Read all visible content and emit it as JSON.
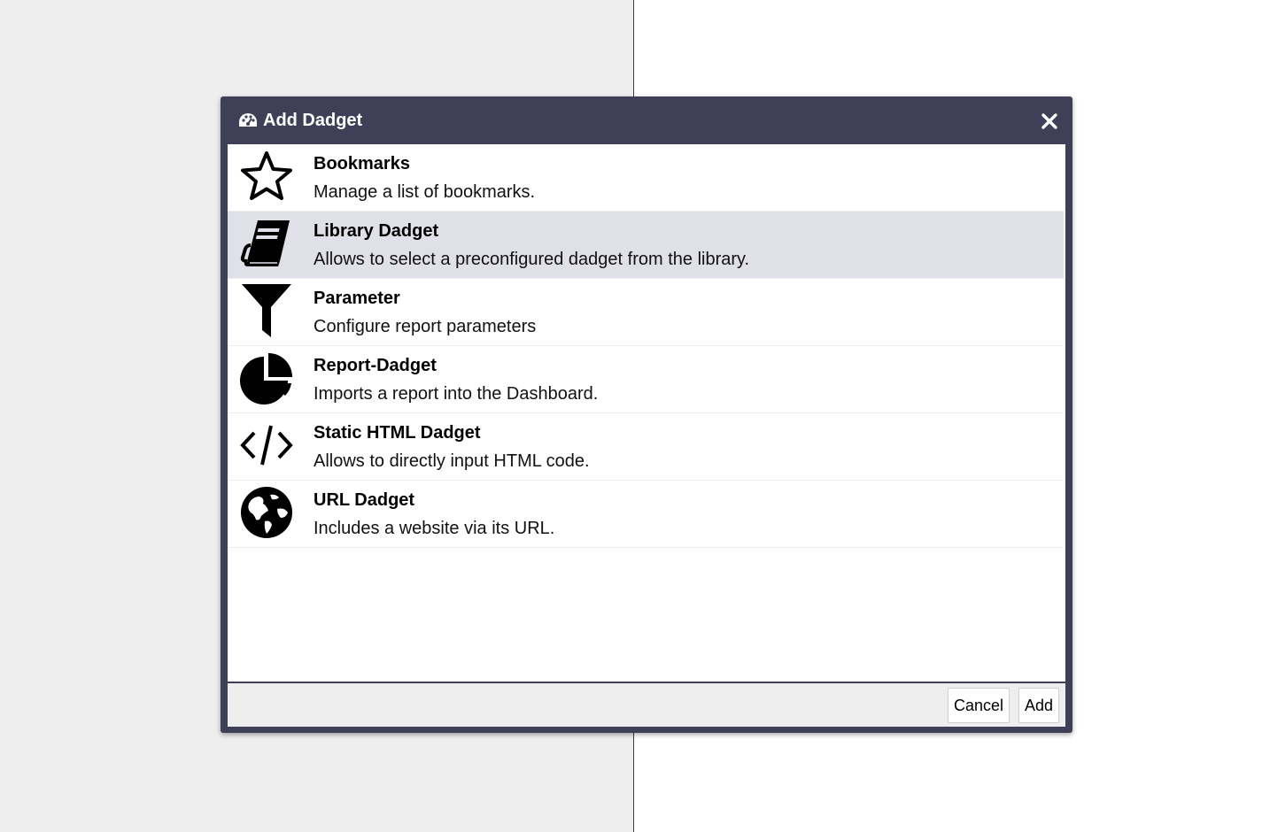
{
  "dialog": {
    "title": "Add Dadget",
    "title_icon": "tachometer-icon",
    "close_icon": "close-icon"
  },
  "items": [
    {
      "title": "Bookmarks",
      "description": "Manage a list of bookmarks.",
      "icon": "star-icon",
      "selected": false
    },
    {
      "title": "Library Dadget",
      "description": "Allows to select a preconfigured dadget from the library.",
      "icon": "book-icon",
      "selected": true
    },
    {
      "title": "Parameter",
      "description": "Configure report parameters",
      "icon": "filter-icon",
      "selected": false
    },
    {
      "title": "Report-Dadget",
      "description": "Imports a report into the Dashboard.",
      "icon": "pie-chart-icon",
      "selected": false
    },
    {
      "title": "Static HTML Dadget",
      "description": "Allows to directly input HTML code.",
      "icon": "code-icon",
      "selected": false
    },
    {
      "title": "URL Dadget",
      "description": "Includes a website via its URL.",
      "icon": "globe-icon",
      "selected": false
    }
  ],
  "footer": {
    "cancel_label": "Cancel",
    "add_label": "Add"
  },
  "colors": {
    "dialog_frame": "#3f4058",
    "selected_row": "#e0e0e9",
    "left_background": "#eeeeee"
  }
}
